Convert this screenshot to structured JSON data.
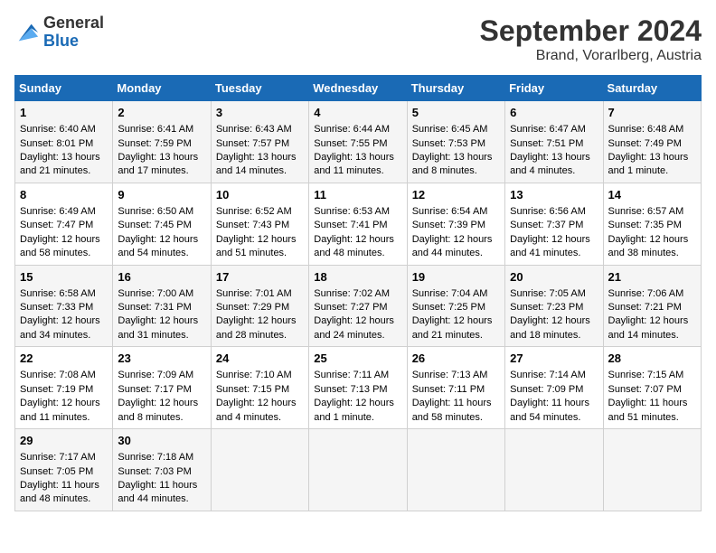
{
  "header": {
    "logo_general": "General",
    "logo_blue": "Blue",
    "title": "September 2024",
    "subtitle": "Brand, Vorarlberg, Austria"
  },
  "calendar": {
    "days": [
      "Sunday",
      "Monday",
      "Tuesday",
      "Wednesday",
      "Thursday",
      "Friday",
      "Saturday"
    ],
    "weeks": [
      [
        {
          "day": "",
          "content": ""
        },
        {
          "day": "2",
          "content": "Sunrise: 6:41 AM\nSunset: 7:59 PM\nDaylight: 13 hours and 17 minutes."
        },
        {
          "day": "3",
          "content": "Sunrise: 6:43 AM\nSunset: 7:57 PM\nDaylight: 13 hours and 14 minutes."
        },
        {
          "day": "4",
          "content": "Sunrise: 6:44 AM\nSunset: 7:55 PM\nDaylight: 13 hours and 11 minutes."
        },
        {
          "day": "5",
          "content": "Sunrise: 6:45 AM\nSunset: 7:53 PM\nDaylight: 13 hours and 8 minutes."
        },
        {
          "day": "6",
          "content": "Sunrise: 6:47 AM\nSunset: 7:51 PM\nDaylight: 13 hours and 4 minutes."
        },
        {
          "day": "7",
          "content": "Sunrise: 6:48 AM\nSunset: 7:49 PM\nDaylight: 13 hours and 1 minute."
        }
      ],
      [
        {
          "day": "8",
          "content": "Sunrise: 6:49 AM\nSunset: 7:47 PM\nDaylight: 12 hours and 58 minutes."
        },
        {
          "day": "9",
          "content": "Sunrise: 6:50 AM\nSunset: 7:45 PM\nDaylight: 12 hours and 54 minutes."
        },
        {
          "day": "10",
          "content": "Sunrise: 6:52 AM\nSunset: 7:43 PM\nDaylight: 12 hours and 51 minutes."
        },
        {
          "day": "11",
          "content": "Sunrise: 6:53 AM\nSunset: 7:41 PM\nDaylight: 12 hours and 48 minutes."
        },
        {
          "day": "12",
          "content": "Sunrise: 6:54 AM\nSunset: 7:39 PM\nDaylight: 12 hours and 44 minutes."
        },
        {
          "day": "13",
          "content": "Sunrise: 6:56 AM\nSunset: 7:37 PM\nDaylight: 12 hours and 41 minutes."
        },
        {
          "day": "14",
          "content": "Sunrise: 6:57 AM\nSunset: 7:35 PM\nDaylight: 12 hours and 38 minutes."
        }
      ],
      [
        {
          "day": "15",
          "content": "Sunrise: 6:58 AM\nSunset: 7:33 PM\nDaylight: 12 hours and 34 minutes."
        },
        {
          "day": "16",
          "content": "Sunrise: 7:00 AM\nSunset: 7:31 PM\nDaylight: 12 hours and 31 minutes."
        },
        {
          "day": "17",
          "content": "Sunrise: 7:01 AM\nSunset: 7:29 PM\nDaylight: 12 hours and 28 minutes."
        },
        {
          "day": "18",
          "content": "Sunrise: 7:02 AM\nSunset: 7:27 PM\nDaylight: 12 hours and 24 minutes."
        },
        {
          "day": "19",
          "content": "Sunrise: 7:04 AM\nSunset: 7:25 PM\nDaylight: 12 hours and 21 minutes."
        },
        {
          "day": "20",
          "content": "Sunrise: 7:05 AM\nSunset: 7:23 PM\nDaylight: 12 hours and 18 minutes."
        },
        {
          "day": "21",
          "content": "Sunrise: 7:06 AM\nSunset: 7:21 PM\nDaylight: 12 hours and 14 minutes."
        }
      ],
      [
        {
          "day": "22",
          "content": "Sunrise: 7:08 AM\nSunset: 7:19 PM\nDaylight: 12 hours and 11 minutes."
        },
        {
          "day": "23",
          "content": "Sunrise: 7:09 AM\nSunset: 7:17 PM\nDaylight: 12 hours and 8 minutes."
        },
        {
          "day": "24",
          "content": "Sunrise: 7:10 AM\nSunset: 7:15 PM\nDaylight: 12 hours and 4 minutes."
        },
        {
          "day": "25",
          "content": "Sunrise: 7:11 AM\nSunset: 7:13 PM\nDaylight: 12 hours and 1 minute."
        },
        {
          "day": "26",
          "content": "Sunrise: 7:13 AM\nSunset: 7:11 PM\nDaylight: 11 hours and 58 minutes."
        },
        {
          "day": "27",
          "content": "Sunrise: 7:14 AM\nSunset: 7:09 PM\nDaylight: 11 hours and 54 minutes."
        },
        {
          "day": "28",
          "content": "Sunrise: 7:15 AM\nSunset: 7:07 PM\nDaylight: 11 hours and 51 minutes."
        }
      ],
      [
        {
          "day": "29",
          "content": "Sunrise: 7:17 AM\nSunset: 7:05 PM\nDaylight: 11 hours and 48 minutes."
        },
        {
          "day": "30",
          "content": "Sunrise: 7:18 AM\nSunset: 7:03 PM\nDaylight: 11 hours and 44 minutes."
        },
        {
          "day": "",
          "content": ""
        },
        {
          "day": "",
          "content": ""
        },
        {
          "day": "",
          "content": ""
        },
        {
          "day": "",
          "content": ""
        },
        {
          "day": "",
          "content": ""
        }
      ]
    ],
    "first_week_day1": {
      "day": "1",
      "content": "Sunrise: 6:40 AM\nSunset: 8:01 PM\nDaylight: 13 hours and 21 minutes."
    }
  }
}
